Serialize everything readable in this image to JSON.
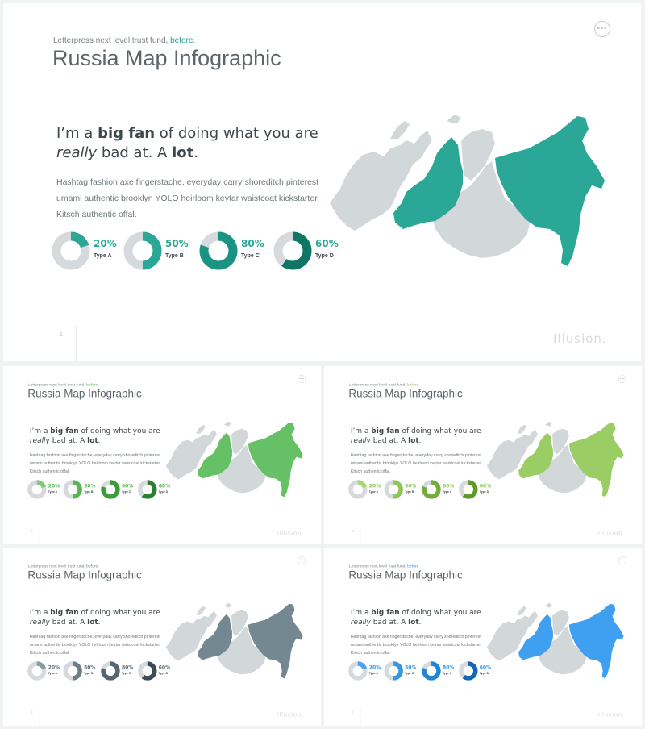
{
  "slide": {
    "subtitle_text": "Letterpress next level trust fund,",
    "subtitle_accent": "before.",
    "title": "Russia Map Infographic",
    "menu_dots": "•••",
    "headline_prefix": "I’m a",
    "headline_bold": "big fan",
    "headline_mid": "of doing what you are",
    "headline_italic": "really",
    "headline_mid2": "bad at. A",
    "headline_bold2": "lot",
    "headline_end": ".",
    "body": "Hashtag fashion axe fingerstache, everyday carry shoreditch pinterest umami authentic brooklyn YOLO heirloom keytar waistcoat kickstarter. Kitsch authentic offal.",
    "page_number": "1",
    "brand": "Illusion."
  },
  "stats": [
    {
      "percent": 20,
      "label": "20%",
      "type": "Type A"
    },
    {
      "percent": 50,
      "label": "50%",
      "type": "Type B"
    },
    {
      "percent": 80,
      "label": "80%",
      "type": "Type C"
    },
    {
      "percent": 60,
      "label": "60%",
      "type": "Type D"
    }
  ],
  "themes": [
    {
      "name": "teal",
      "donuts": [
        "#2aa796",
        "#2aa796",
        "#1b9382",
        "#0f7565"
      ],
      "pct_color": "#2aa796",
      "map_highlight": "#2aa796",
      "subtitle_accent": "#2a9d8f"
    },
    {
      "name": "green",
      "donuts": [
        "#7fcb77",
        "#5bb555",
        "#3e9c3b",
        "#2c7f2c"
      ],
      "pct_color": "#5bb555",
      "map_highlight": "#66c065",
      "subtitle_accent": "#5bb555"
    },
    {
      "name": "lime",
      "donuts": [
        "#a9d774",
        "#8dc657",
        "#72ad3b",
        "#5d9a2a"
      ],
      "pct_color": "#8dc657",
      "map_highlight": "#9acd63",
      "subtitle_accent": "#8dc657"
    },
    {
      "name": "slate",
      "donuts": [
        "#8a9aa3",
        "#6c7f89",
        "#54666f",
        "#3c4c54"
      ],
      "pct_color": "#5c6b73",
      "map_highlight": "#748891",
      "subtitle_accent": "#748891"
    },
    {
      "name": "blue",
      "donuts": [
        "#4aa3ec",
        "#3396e6",
        "#1f84da",
        "#1567b5"
      ],
      "pct_color": "#3396e6",
      "map_highlight": "#3f9ff0",
      "subtitle_accent": "#3396e6"
    }
  ],
  "colors": {
    "map_base": "#d2d7da",
    "donut_track": "#d6dadc",
    "text_dark": "#3e474b"
  }
}
